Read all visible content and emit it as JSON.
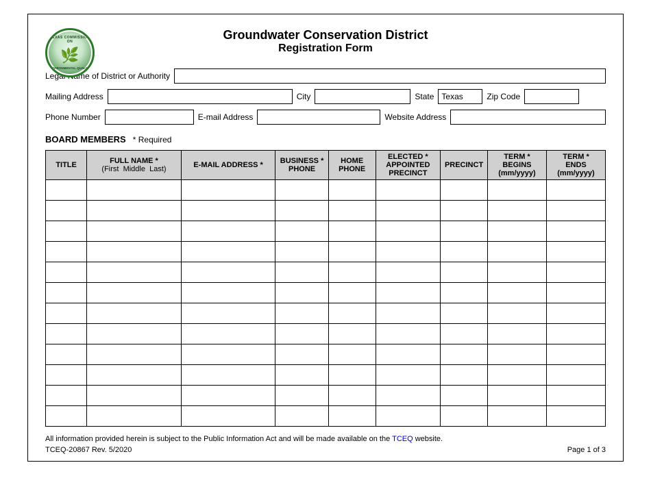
{
  "header": {
    "title_main": "Groundwater Conservation District",
    "title_sub": "Registration Form"
  },
  "logo": {
    "alt": "Texas Commission on Environmental Quality",
    "text_top": "TEXAS COMMISSION ON",
    "text_bottom": "ENVIRONMENTAL QUALITY"
  },
  "form": {
    "legal_name_label": "Legal Name of District or Authority",
    "mailing_address_label": "Mailing Address",
    "city_label": "City",
    "state_label": "State",
    "state_value": "Texas",
    "zip_label": "Zip Code",
    "phone_label": "Phone Number",
    "email_label": "E-mail Address",
    "website_label": "Website Address"
  },
  "board": {
    "title": "BOARD MEMBERS",
    "required_note": "* Required",
    "columns": [
      {
        "id": "title",
        "header_lines": [
          "TITLE"
        ]
      },
      {
        "id": "fullname",
        "header_lines": [
          "FULL NAME *",
          "(First  Middle  Last)"
        ]
      },
      {
        "id": "email",
        "header_lines": [
          "E-MAIL ADDRESS *"
        ]
      },
      {
        "id": "bizphone",
        "header_lines": [
          "BUSINESS *",
          "PHONE"
        ]
      },
      {
        "id": "homephone",
        "header_lines": [
          "HOME",
          "PHONE"
        ]
      },
      {
        "id": "elected",
        "header_lines": [
          "ELECTED *",
          "APPOINTED",
          "PRECINCT"
        ]
      },
      {
        "id": "precinct",
        "header_lines": [
          "PRECINCT"
        ]
      },
      {
        "id": "termbegins",
        "header_lines": [
          "TERM *",
          "BEGINS",
          "(mm/yyyy)"
        ]
      },
      {
        "id": "termends",
        "header_lines": [
          "TERM *",
          "ENDS",
          "(mm/yyyy)"
        ]
      }
    ],
    "data_rows": 12
  },
  "footer": {
    "note": "All information provided herein is subject to the Public Information Act and will be made available on the ",
    "link_text": "TCEQ",
    "note_end": " website.",
    "revision": "TCEQ-20867  Rev. 5/2020",
    "page": "Page 1 of 3"
  }
}
